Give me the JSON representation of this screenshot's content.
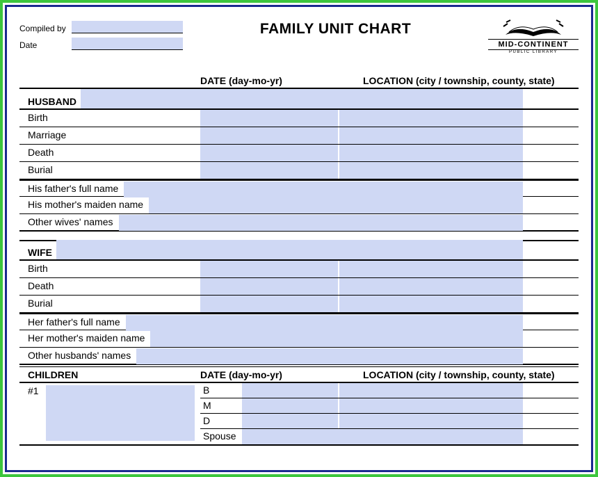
{
  "header": {
    "compiled_by_label": "Compiled by",
    "date_label": "Date",
    "title": "FAMILY UNIT CHART",
    "logo_main": "MID-CONTINENT",
    "logo_sub": "PUBLIC LIBRARY"
  },
  "columns": {
    "date": "DATE (day-mo-yr)",
    "location": "LOCATION (city / township, county, state)"
  },
  "husband": {
    "label": "HUSBAND",
    "events": {
      "birth": "Birth",
      "marriage": "Marriage",
      "death": "Death",
      "burial": "Burial"
    },
    "father_label": "His father's full name",
    "mother_label": "His mother's maiden name",
    "other_spouses_label": "Other wives' names"
  },
  "wife": {
    "label": "WIFE",
    "events": {
      "birth": "Birth",
      "death": "Death",
      "burial": "Burial"
    },
    "father_label": "Her father's full name",
    "mother_label": "Her mother's maiden name",
    "other_spouses_label": "Other husbands' names"
  },
  "children": {
    "label": "CHILDREN",
    "num1": "#1",
    "short": {
      "b": "B",
      "m": "M",
      "d": "D",
      "spouse": "Spouse"
    }
  }
}
